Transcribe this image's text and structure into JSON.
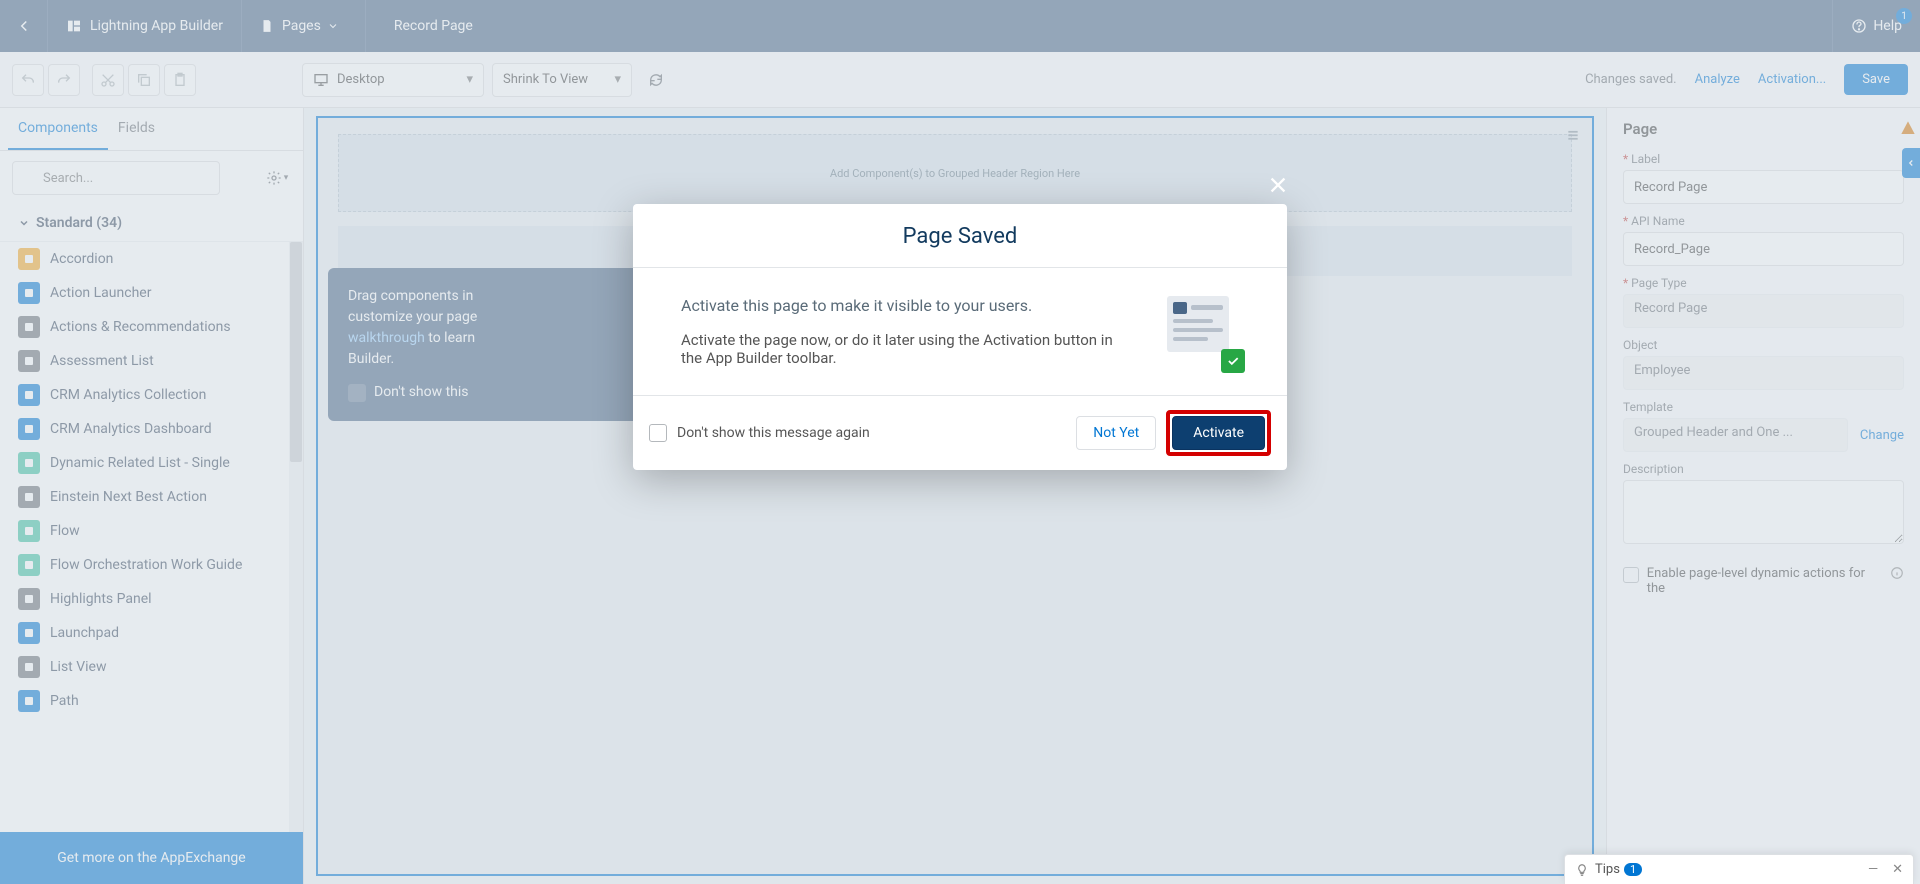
{
  "header": {
    "app_title": "Lightning App Builder",
    "pages_label": "Pages",
    "record_title": "Record Page",
    "help_label": "Help",
    "help_badge": "1"
  },
  "toolbar": {
    "desktop_label": "Desktop",
    "zoom_label": "Shrink To View",
    "status_msg": "Changes saved.",
    "analyze_label": "Analyze",
    "activation_label": "Activation...",
    "save_label": "Save"
  },
  "sidebar": {
    "tabs": {
      "components": "Components",
      "fields": "Fields"
    },
    "search_placeholder": "Search...",
    "section_label": "Standard (34)",
    "items": [
      {
        "label": "Accordion",
        "color": "#f5a623"
      },
      {
        "label": "Action Launcher",
        "color": "#0176d3"
      },
      {
        "label": "Actions & Recommendations",
        "color": "#6b7075"
      },
      {
        "label": "Assessment List",
        "color": "#6b7075"
      },
      {
        "label": "CRM Analytics Collection",
        "color": "#0176d3"
      },
      {
        "label": "CRM Analytics Dashboard",
        "color": "#0176d3"
      },
      {
        "label": "Dynamic Related List - Single",
        "color": "#3ac2a0"
      },
      {
        "label": "Einstein Next Best Action",
        "color": "#6b7075"
      },
      {
        "label": "Flow",
        "color": "#3ac2a0"
      },
      {
        "label": "Flow Orchestration Work Guide",
        "color": "#3ac2a0"
      },
      {
        "label": "Highlights Panel",
        "color": "#6b7075"
      },
      {
        "label": "Launchpad",
        "color": "#0176d3"
      },
      {
        "label": "List View",
        "color": "#6b7075"
      },
      {
        "label": "Path",
        "color": "#0176d3"
      }
    ],
    "appexchange": "Get more on the AppExchange"
  },
  "canvas": {
    "header_region_hint": "Add Component(s) to Grouped Header Region Here",
    "callout_line1": "Drag components in",
    "callout_line2": "customize your page",
    "callout_walkthrough": "walkthrough",
    "callout_line3a": " to learn",
    "callout_line4": "Builder.",
    "callout_dont_show": "Don't show this"
  },
  "rpanel": {
    "title": "Page",
    "label_field": "Label",
    "label_value": "Record Page",
    "api_field": "API Name",
    "api_value": "Record_Page",
    "pagetype_field": "Page Type",
    "pagetype_value": "Record Page",
    "object_field": "Object",
    "object_value": "Employee",
    "template_field": "Template",
    "template_value": "Grouped Header and One ...",
    "change_label": "Change",
    "description_field": "Description",
    "enable_label": "Enable page-level dynamic actions for the"
  },
  "modal": {
    "title": "Page Saved",
    "lead": "Activate this page to make it visible to your users.",
    "body": "Activate the page now, or do it later using the Activation button in the App Builder toolbar.",
    "dont_show": "Don't show this message again",
    "not_yet": "Not Yet",
    "activate": "Activate"
  },
  "tips": {
    "label": "Tips",
    "count": "1"
  }
}
